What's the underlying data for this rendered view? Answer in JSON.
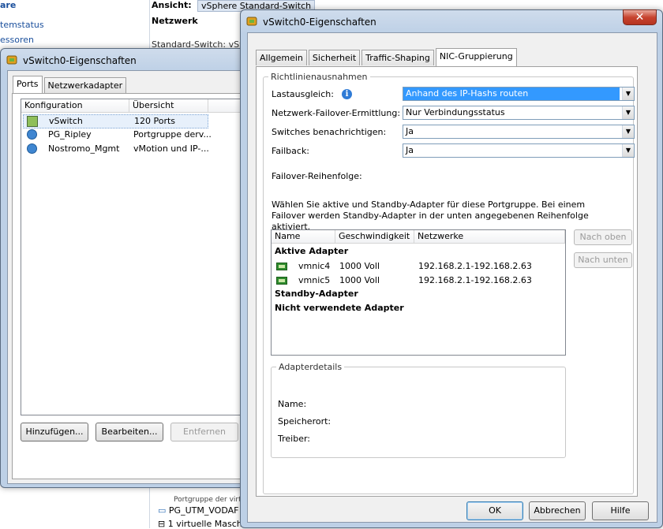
{
  "background": {
    "left_items": [
      "are",
      "temstatus",
      "essoren"
    ],
    "view_label": "Ansicht:",
    "view_value": "vSphere Standard-Switch",
    "network_label": "Netzwerk",
    "std_switch": "Standard-Switch: vSwi",
    "bottom": {
      "portgroup": "Portgruppe der virtu",
      "pg_name": "PG_UTM_VODAF",
      "vm_count": "1 virtuelle Masch"
    }
  },
  "back_window": {
    "title": "vSwitch0-Eigenschaften",
    "tabs": [
      "Ports",
      "Netzwerkadapter"
    ],
    "columns": [
      "Konfiguration",
      "Übersicht"
    ],
    "rows": [
      {
        "icon": "switch-icon",
        "name": "vSwitch",
        "summary": "120 Ports"
      },
      {
        "icon": "network-icon",
        "name": "PG_Ripley",
        "summary": "Portgruppe derv..."
      },
      {
        "icon": "network-icon",
        "name": "Nostromo_Mgmt",
        "summary": "vMotion und IP-..."
      }
    ],
    "buttons": {
      "add": "Hinzufügen...",
      "edit": "Bearbeiten...",
      "remove": "Entfernen"
    }
  },
  "front_window": {
    "title": "vSwitch0-Eigenschaften",
    "close": "✕",
    "tabs": [
      "Allgemein",
      "Sicherheit",
      "Traffic-Shaping",
      "NIC-Gruppierung"
    ],
    "active_tab": "NIC-Gruppierung",
    "policy_group": "Richtlinienausnahmen",
    "fields": {
      "load_balancing": {
        "label": "Lastausgleich:",
        "value": "Anhand des IP-Hashs routen"
      },
      "failover_detection": {
        "label": "Netzwerk-Failover-Ermittlung:",
        "value": "Nur Verbindungsstatus"
      },
      "notify_switches": {
        "label": "Switches benachrichtigen:",
        "value": "Ja"
      },
      "failback": {
        "label": "Failback:",
        "value": "Ja"
      }
    },
    "failover_order_label": "Failover-Reihenfolge:",
    "description": "Wählen Sie aktive und Standby-Adapter für diese Portgruppe. Bei einem Failover werden Standby-Adapter in der unten angegebenen Reihenfolge aktiviert.",
    "adapter_columns": [
      "Name",
      "Geschwindigkeit",
      "Netzwerke"
    ],
    "active_header": "Aktive Adapter",
    "active_adapters": [
      {
        "name": "vmnic4",
        "speed": "1000 Voll",
        "networks": "192.168.2.1-192.168.2.63"
      },
      {
        "name": "vmnic5",
        "speed": "1000 Voll",
        "networks": "192.168.2.1-192.168.2.63"
      }
    ],
    "standby_header": "Standby-Adapter",
    "unused_header": "Nicht verwendete Adapter",
    "move_up": "Nach oben",
    "move_down": "Nach unten",
    "details_group": "Adapterdetails",
    "details": {
      "name": "Name:",
      "location": "Speicherort:",
      "driver": "Treiber:"
    },
    "buttons": {
      "ok": "OK",
      "cancel": "Abbrechen",
      "help": "Hilfe"
    }
  }
}
